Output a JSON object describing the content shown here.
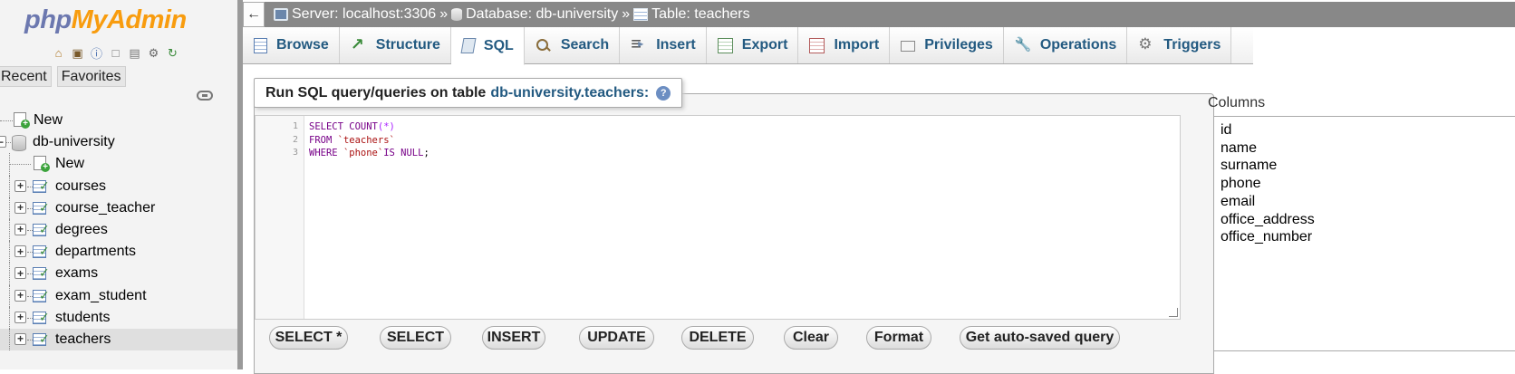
{
  "nav": {
    "logo": {
      "part1": "php",
      "part2": "MyAdmin"
    },
    "tabs": [
      "Recent",
      "Favorites"
    ],
    "tree": [
      {
        "label": "New",
        "level": 0,
        "type": "new"
      },
      {
        "label": "db-university",
        "level": 0,
        "type": "db"
      },
      {
        "label": "New",
        "level": 1,
        "type": "new"
      },
      {
        "label": "courses",
        "level": 1,
        "type": "table"
      },
      {
        "label": "course_teacher",
        "level": 1,
        "type": "table"
      },
      {
        "label": "degrees",
        "level": 1,
        "type": "table"
      },
      {
        "label": "departments",
        "level": 1,
        "type": "table"
      },
      {
        "label": "exams",
        "level": 1,
        "type": "table"
      },
      {
        "label": "exam_student",
        "level": 1,
        "type": "table"
      },
      {
        "label": "students",
        "level": 1,
        "type": "table"
      },
      {
        "label": "teachers",
        "level": 1,
        "type": "table",
        "selected": true
      }
    ]
  },
  "breadcrumb": {
    "back": "←",
    "server": "Server: localhost:3306",
    "database": "Database: db-university",
    "table": "Table: teachers",
    "sep": "»"
  },
  "tabs": [
    "Browse",
    "Structure",
    "SQL",
    "Search",
    "Insert",
    "Export",
    "Import",
    "Privileges",
    "Operations",
    "Triggers"
  ],
  "active_tab": "SQL",
  "query": {
    "legend_prefix": "Run SQL query/queries on table",
    "legend_table": "db-university.teachers:",
    "help": "?",
    "lines": [
      "1",
      "2",
      "3"
    ]
  },
  "buttons": [
    "SELECT *",
    "SELECT",
    "INSERT",
    "UPDATE",
    "DELETE",
    "Clear",
    "Format",
    "Get auto-saved query"
  ],
  "columns": {
    "label": "Columns",
    "items": [
      "id",
      "name",
      "surname",
      "phone",
      "email",
      "office_address",
      "office_number"
    ]
  },
  "colors": {
    "accent": "#235a81",
    "logo_blue": "#6c78af",
    "logo_orange": "#f89c0e",
    "breadcrumb_bg": "#888888"
  }
}
